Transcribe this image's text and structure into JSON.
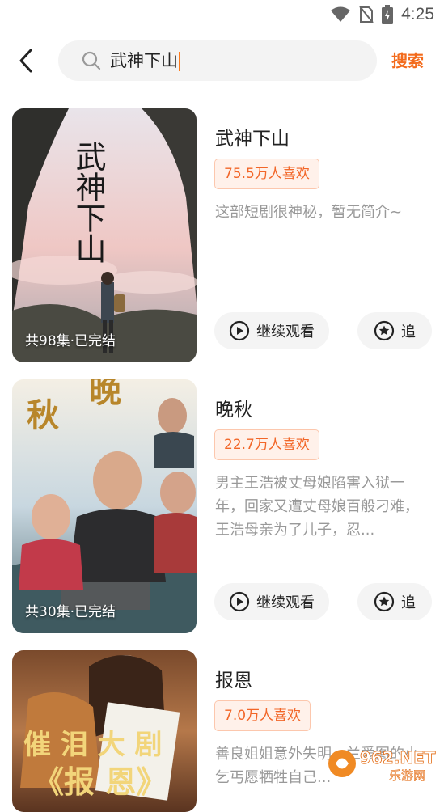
{
  "status_bar": {
    "time": "4:25"
  },
  "search": {
    "query": "武神下山",
    "button_label": "搜索"
  },
  "results": [
    {
      "title": "武神下山",
      "likes": "75.5万人喜欢",
      "intro": "这部短剧很神秘，暂无简介~",
      "episodes": "共98集·已完结",
      "poster_title": "武神下山",
      "continue_label": "继续观看",
      "follow_label": "追"
    },
    {
      "title": "晚秋",
      "likes": "22.7万人喜欢",
      "intro": "男主王浩被丈母娘陷害入狱一年，回家又遭丈母娘百般刁难，王浩母亲为了儿子，忍...",
      "episodes": "共30集·已完结",
      "poster_title": "晚秋",
      "continue_label": "继续观看",
      "follow_label": "追"
    },
    {
      "title": "报恩",
      "likes": "7.0万人喜欢",
      "intro": "善良姐姐意外失明，兰爱图的小乞丐愿牺牲自己...",
      "poster_title": "催泪大剧 《报恩》"
    }
  ],
  "watermark": {
    "brand": "962.NET",
    "sub": "乐游网"
  }
}
